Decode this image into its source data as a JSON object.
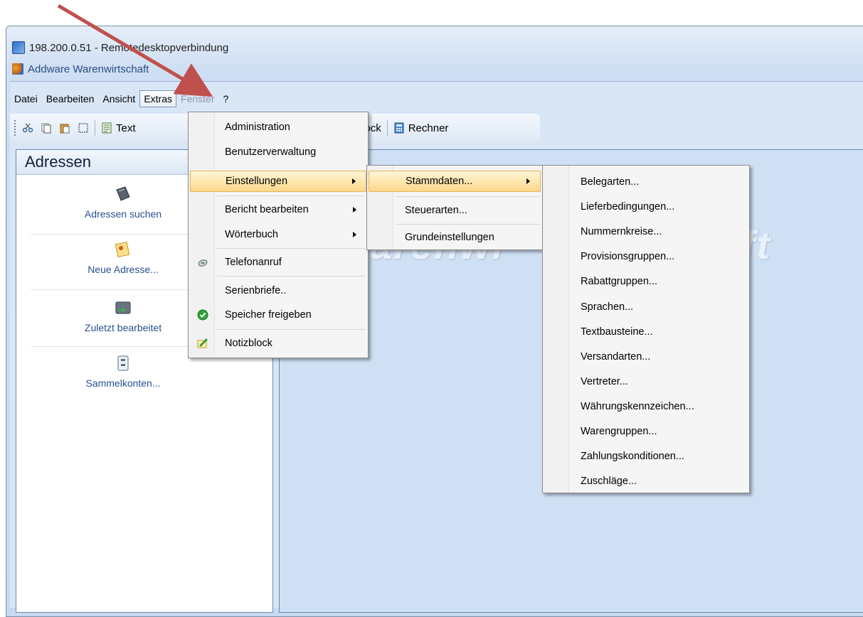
{
  "window": {
    "rdp_title": "198.200.0.51 - Remotedesktopverbindung",
    "app_title": "Addware Warenwirtschaft"
  },
  "menubar": [
    {
      "label": "Datei",
      "state": "normal"
    },
    {
      "label": "Bearbeiten",
      "state": "normal"
    },
    {
      "label": "Ansicht",
      "state": "normal"
    },
    {
      "label": "Extras",
      "state": "active"
    },
    {
      "label": "Fenster",
      "state": "disabled"
    },
    {
      "label": "?",
      "state": "normal"
    }
  ],
  "toolbar": {
    "text_label": "Text",
    "notizblock_label": "Notizblock",
    "rechner_label": "Rechner"
  },
  "panel": {
    "title": "Adressen",
    "items": [
      {
        "label": "Adressen suchen",
        "icon": "address-book-icon"
      },
      {
        "label": "Neue Adresse...",
        "icon": "new-address-icon"
      },
      {
        "label": "Zuletzt bearbeitet",
        "icon": "recent-edited-icon"
      },
      {
        "label": "Sammelkonten...",
        "icon": "collective-accounts-icon"
      }
    ]
  },
  "watermark": "arenwi",
  "watermark_right": "aft",
  "extras_menu": [
    {
      "label": "Administration"
    },
    {
      "label": "Benutzerverwaltung"
    },
    {
      "label": "Einstellungen",
      "submenu": true,
      "highlighted": true
    },
    {
      "label": "Bericht bearbeiten",
      "submenu": true
    },
    {
      "label": "Wörterbuch",
      "submenu": true
    },
    {
      "label": "Telefonanruf",
      "icon": "phone-icon"
    },
    {
      "label": "Serienbriefe.."
    },
    {
      "label": "Speicher freigeben",
      "icon": "green-check-icon"
    },
    {
      "label": "Notizblock",
      "icon": "notepad-icon"
    }
  ],
  "einstellungen_menu": [
    {
      "label": "Stammdaten...",
      "submenu": true,
      "highlighted": true
    },
    {
      "label": "Steuerarten..."
    },
    {
      "label": "Grundeinstellungen"
    }
  ],
  "stammdaten_menu": [
    "Belegarten...",
    "Lieferbedingungen...",
    "Nummernkreise...",
    "Provisionsgruppen...",
    "Rabattgruppen...",
    "Sprachen...",
    "Textbausteine...",
    "Versandarten...",
    "Vertreter...",
    "Währungskennzeichen...",
    "Warengruppen...",
    "Zahlungskonditionen...",
    "Zuschläge..."
  ],
  "colors": {
    "highlight": "#fbd88a",
    "annotation_arrow": "#c0504d",
    "link_text": "#2a4f8f"
  }
}
